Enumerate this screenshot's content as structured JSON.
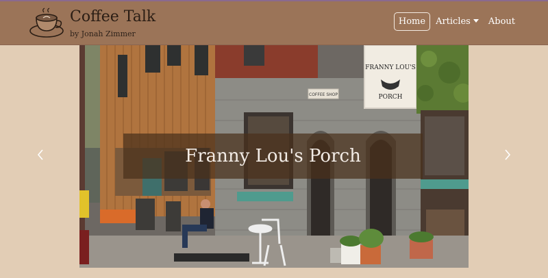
{
  "brand": {
    "title": "Coffee Talk",
    "subtitle": "by Jonah Zimmer",
    "logo_icon": "coffee-cup-icon"
  },
  "nav": {
    "items": [
      {
        "label": "Home",
        "active": true
      },
      {
        "label": "Articles",
        "dropdown": true
      },
      {
        "label": "About"
      }
    ]
  },
  "carousel": {
    "slide_caption": "Franny Lou's Porch",
    "sign_text": "FRANNY LOU'S PORCH",
    "small_sign": "COFFEE SHOP",
    "prev_icon": "chevron-left-icon",
    "next_icon": "chevron-right-icon"
  },
  "colors": {
    "page_bg": "#e2cdb5",
    "navbar_bg": "#9b7458",
    "caption_bg": "#4a301c"
  }
}
